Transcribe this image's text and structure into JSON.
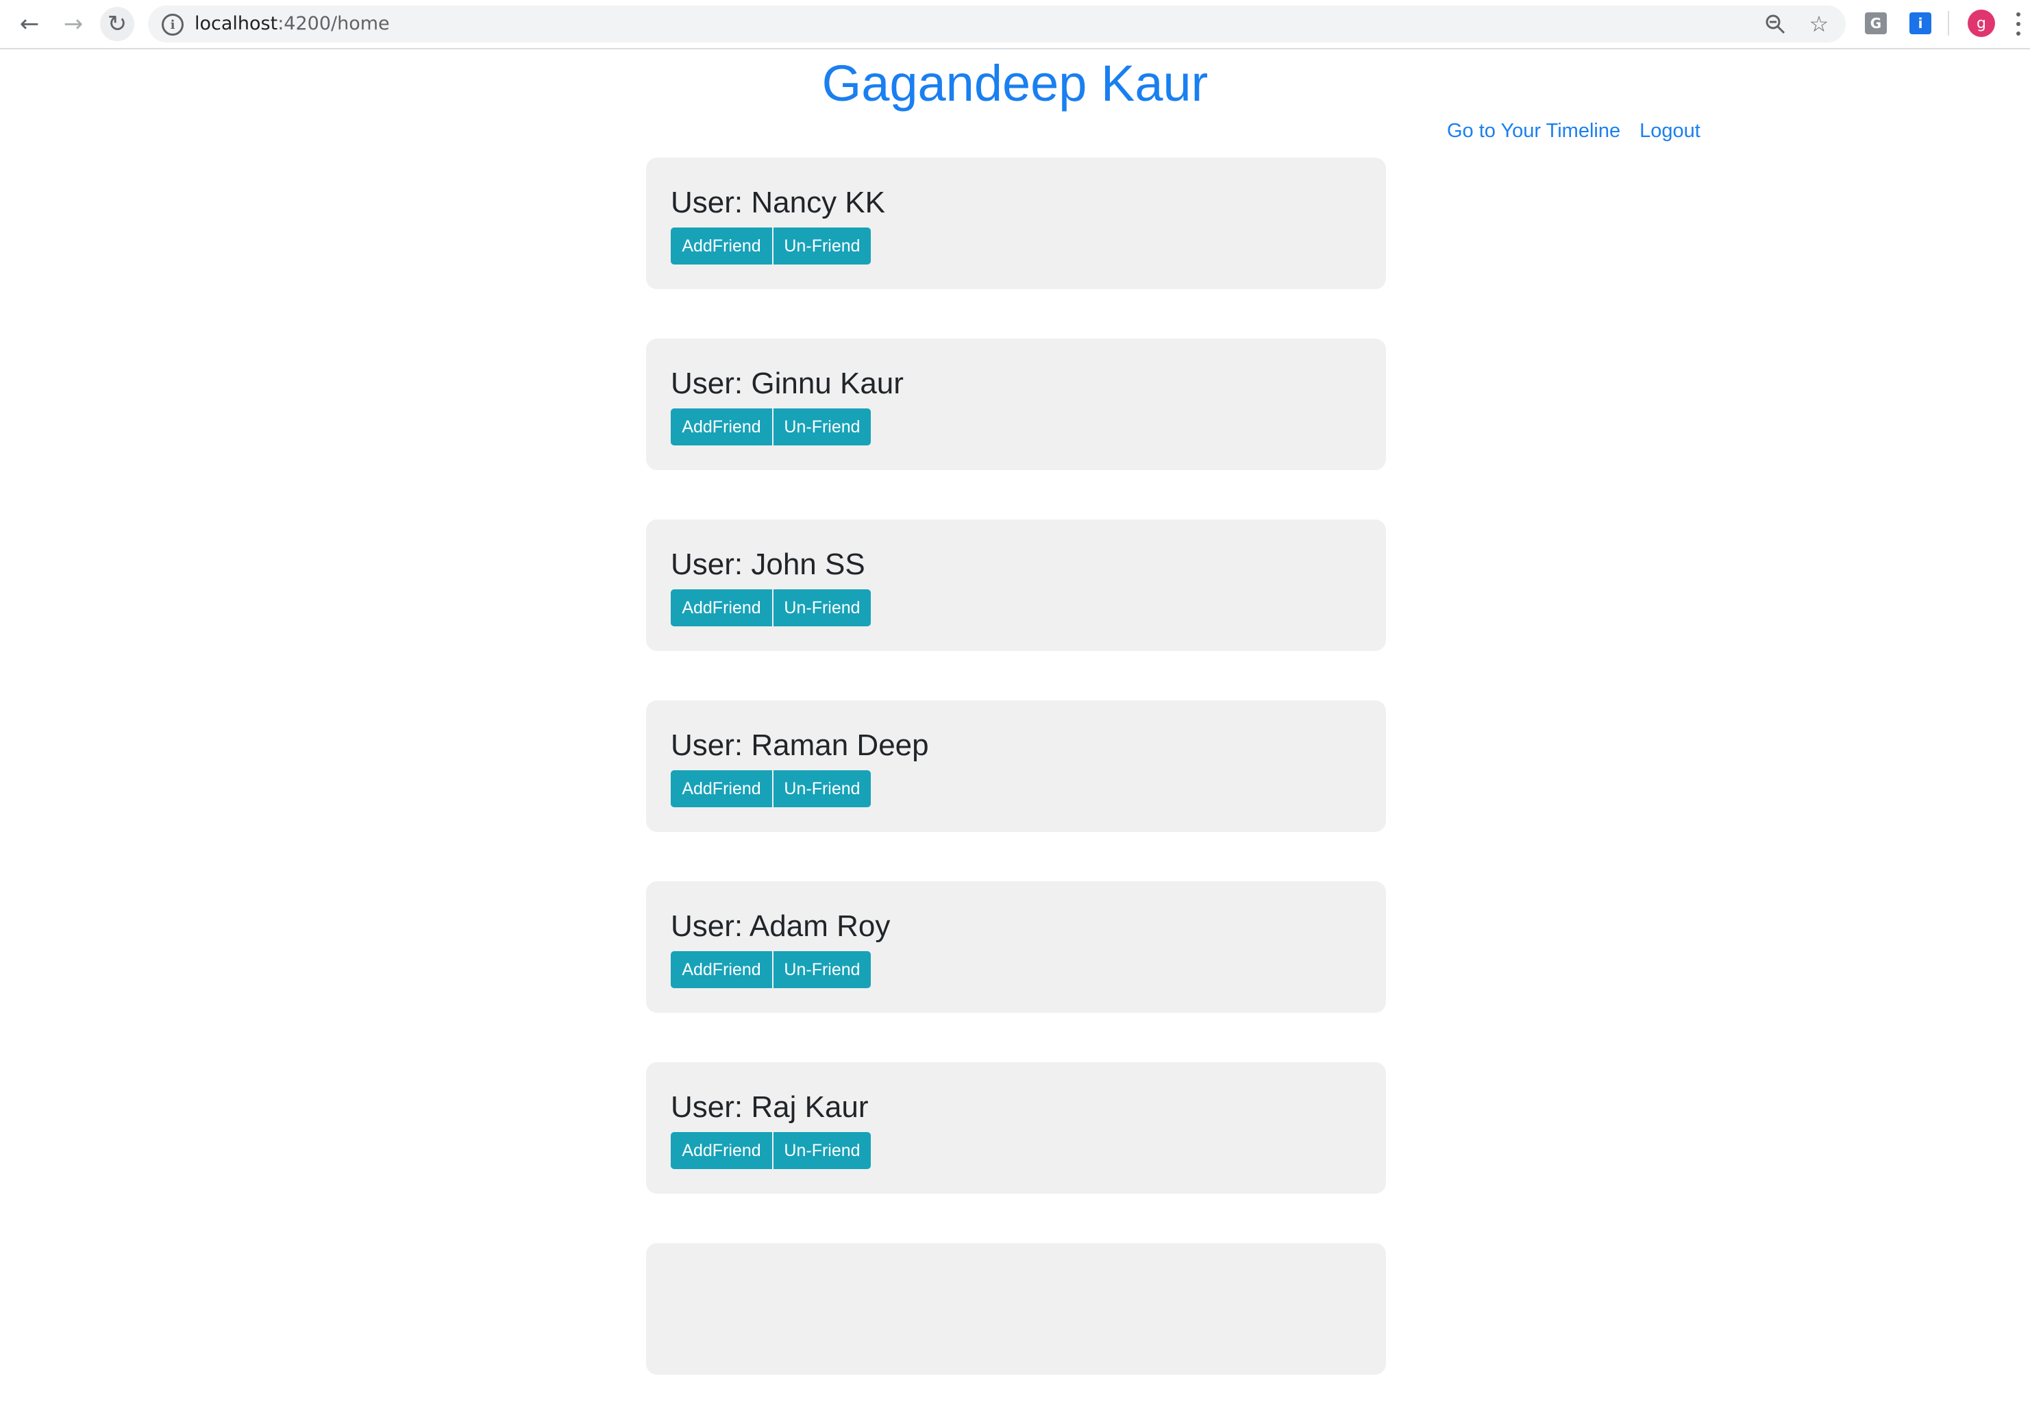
{
  "browser": {
    "url_host": "localhost",
    "url_path": ":4200/home",
    "ext_g_label": "G",
    "ext_i_label": "i",
    "profile_initial": "g"
  },
  "page": {
    "title": "Gagandeep Kaur",
    "links": {
      "timeline": "Go to Your Timeline",
      "logout": "Logout"
    }
  },
  "users": [
    {
      "label": "User: Nancy KK",
      "add": "AddFriend",
      "unfriend": "Un-Friend"
    },
    {
      "label": "User: Ginnu Kaur",
      "add": "AddFriend",
      "unfriend": "Un-Friend"
    },
    {
      "label": "User: John SS",
      "add": "AddFriend",
      "unfriend": "Un-Friend"
    },
    {
      "label": "User: Raman Deep",
      "add": "AddFriend",
      "unfriend": "Un-Friend"
    },
    {
      "label": "User: Adam Roy",
      "add": "AddFriend",
      "unfriend": "Un-Friend"
    },
    {
      "label": "User: Raj Kaur",
      "add": "AddFriend",
      "unfriend": "Un-Friend"
    },
    {
      "label": "",
      "add": "",
      "unfriend": ""
    }
  ],
  "colors": {
    "accent": "#1a7ff0",
    "button": "#17a2b8",
    "card": "#f0f0f0"
  }
}
